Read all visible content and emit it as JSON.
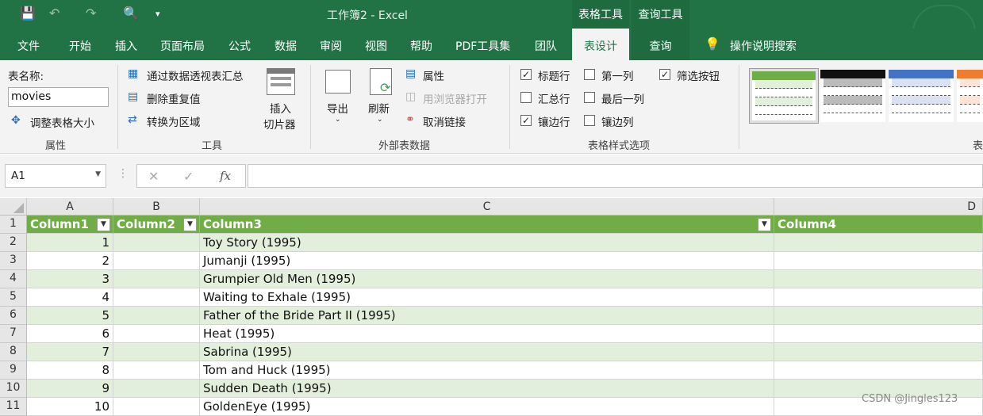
{
  "titlebar": {
    "title": "工作簿2  -  Excel",
    "context_tabs": [
      "表格工具",
      "查询工具"
    ]
  },
  "tabs": [
    "文件",
    "开始",
    "插入",
    "页面布局",
    "公式",
    "数据",
    "审阅",
    "视图",
    "帮助",
    "PDF工具集",
    "团队",
    "表设计",
    "查询"
  ],
  "active_tab": "表设计",
  "search_label": "操作说明搜索",
  "ribbon": {
    "properties": {
      "table_name_label": "表名称:",
      "table_name_value": "movies",
      "resize_label": "调整表格大小",
      "group_label": "属性"
    },
    "tools": {
      "pivot_label": "通过数据透视表汇总",
      "remove_dup_label": "删除重复值",
      "convert_label": "转换为区域",
      "slicer_label_1": "插入",
      "slicer_label_2": "切片器",
      "group_label": "工具"
    },
    "external": {
      "export_label": "导出",
      "refresh_label": "刷新",
      "properties_label": "属性",
      "open_browser_label": "用浏览器打开",
      "unlink_label": "取消链接",
      "group_label": "外部表数据"
    },
    "style_options": {
      "header_row": {
        "label": "标题行",
        "checked": true
      },
      "total_row": {
        "label": "汇总行",
        "checked": false
      },
      "banded_rows": {
        "label": "镶边行",
        "checked": true
      },
      "first_column": {
        "label": "第一列",
        "checked": false
      },
      "last_column": {
        "label": "最后一列",
        "checked": false
      },
      "banded_columns": {
        "label": "镶边列",
        "checked": false
      },
      "filter_button": {
        "label": "筛选按钮",
        "checked": true
      },
      "group_label": "表格样式选项"
    },
    "styles_group_label": "表"
  },
  "formula_bar": {
    "name_box": "A1",
    "fx": "fx",
    "value": ""
  },
  "columns": [
    "A",
    "B",
    "C",
    "D"
  ],
  "table": {
    "headers": [
      "Column1",
      "Column2",
      "Column3",
      "Column4"
    ],
    "rows": [
      {
        "n": "1",
        "title": "Toy Story (1995)"
      },
      {
        "n": "2",
        "title": "Jumanji (1995)"
      },
      {
        "n": "3",
        "title": "Grumpier Old Men (1995)"
      },
      {
        "n": "4",
        "title": "Waiting to Exhale (1995)"
      },
      {
        "n": "5",
        "title": "Father of the Bride Part II (1995)"
      },
      {
        "n": "6",
        "title": "Heat (1995)"
      },
      {
        "n": "7",
        "title": "Sabrina (1995)"
      },
      {
        "n": "8",
        "title": "Tom and Huck (1995)"
      },
      {
        "n": "9",
        "title": "Sudden Death (1995)"
      },
      {
        "n": "10",
        "title": "GoldenEye (1995)"
      }
    ],
    "row_numbers": [
      "1",
      "2",
      "3",
      "4",
      "5",
      "6",
      "7",
      "8",
      "9",
      "10",
      "11"
    ]
  },
  "colors": {
    "brand": "#217346",
    "table_header": "#70ad47",
    "band": "#e2efda"
  },
  "watermark": "CSDN @Jingles123"
}
